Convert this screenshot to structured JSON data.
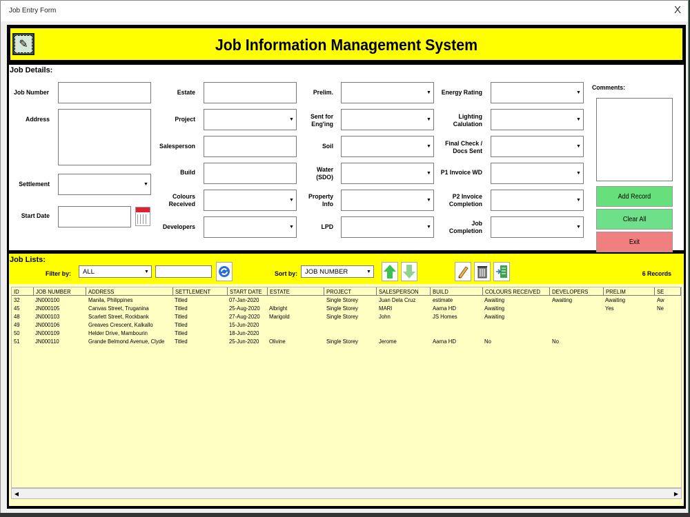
{
  "window": {
    "title": "Job Entry Form",
    "close": "X"
  },
  "banner": {
    "title": "Job Information Management System",
    "edit_icon": "edit-icon"
  },
  "details": {
    "section_label": "Job Details:",
    "labels": {
      "job_number": "Job  Number",
      "address": "Address",
      "settlement": "Settlement",
      "start_date": "Start Date",
      "estate": "Estate",
      "project": "Project",
      "salesperson": "Salesperson",
      "build": "Build",
      "colours_received": "Colours Received",
      "developers": "Developers",
      "prelim": "Prelim.",
      "sent_for_enging": "Sent for Eng'ing",
      "soil": "Soil",
      "water_sdo": "Water (SDO)",
      "property_info": "Property Info",
      "lpd": "LPD",
      "energy_rating": "Energy Rating",
      "lighting_calculation": "Lighting Calulation",
      "final_check": "Final Check / Docs Sent",
      "p1_invoice": "P1 Invoice WD",
      "p2_invoice": "P2 Invoice Completion",
      "job_completion": "Job Completion",
      "comments": "Comments:"
    },
    "buttons": {
      "add_record": "Add Record",
      "clear_all": "Clear All",
      "exit": "Exit"
    }
  },
  "lists": {
    "section_label": "Job Lists:",
    "filter_label": "Filter by:",
    "filter_value": "ALL",
    "sort_label": "Sort by:",
    "sort_value": "JOB  NUMBER",
    "record_count": "6 Records",
    "columns": [
      "ID",
      "JOB NUMBER",
      "ADDRESS",
      "SETTLEMENT",
      "START DATE",
      "ESTATE",
      "PROJECT",
      "SALESPERSON",
      "BUILD",
      "COLOURS RECEIVED",
      "DEVELOPERS",
      "PRELIM",
      "SE"
    ],
    "rows": [
      [
        "32",
        "JN000100",
        "Manila, Philippines",
        "Titled",
        "07-Jan-2020",
        "",
        "Single Storey",
        "Juan Dela Cruz",
        "estimate",
        "Awaiting",
        "Awaiting",
        "Awaiting",
        "Aw"
      ],
      [
        "45",
        "JN000105",
        "Canvas Street, Truganina",
        "Titled",
        "25-Aug-2020",
        "Albright",
        "Single Storey",
        "MARI",
        "Aarna HD",
        "Awaiting",
        "",
        "Yes",
        "Ne"
      ],
      [
        "48",
        "JN000103",
        "Scarlett Street, Rockbank",
        "Titled",
        "27-Aug-2020",
        "Marigold",
        "Single Storey",
        "John",
        "JS Homes",
        "Awaiting",
        "",
        "",
        ""
      ],
      [
        "49",
        "JN000106",
        "Greaves Crescent, Kalkallo",
        "Titled",
        "15-Jun-2020",
        "",
        "",
        "",
        "",
        "",
        "",
        "",
        ""
      ],
      [
        "50",
        "JN000109",
        "Helder Drive, Mambourin",
        "Titled",
        "18-Jun-2020",
        "",
        "",
        "",
        "",
        "",
        "",
        "",
        ""
      ],
      [
        "51",
        "JN000110",
        "Grande Belmond Avenue, Clyde",
        "Titled",
        "25-Jun-2020",
        "Olivine",
        "Single Storey",
        "Jerome",
        "Aarna HD",
        "No",
        "No",
        "",
        ""
      ]
    ]
  },
  "colors": {
    "banner": "#ffff00",
    "list_bg": "#ffffc4",
    "add_btn": "#66e07a",
    "clear_btn": "#6fe08a",
    "exit_btn": "#f08080"
  }
}
